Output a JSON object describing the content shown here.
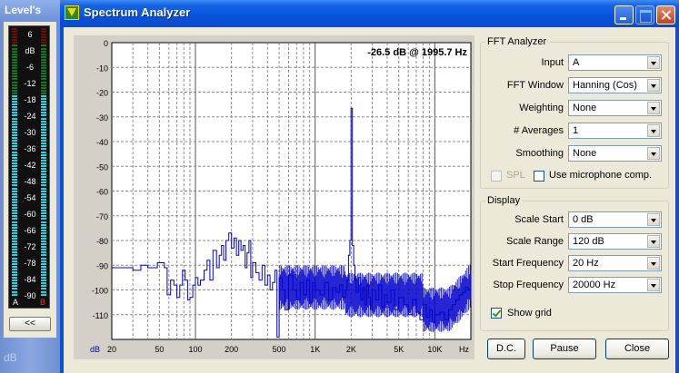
{
  "levels": {
    "title": "Level's",
    "scale": [
      "6",
      "dB",
      "-6",
      "-12",
      "-18",
      "-24",
      "-30",
      "-36",
      "-42",
      "-48",
      "-54",
      "-60",
      "-66",
      "-72",
      "-78",
      "-84",
      "-90"
    ],
    "channel_left": "A",
    "channel_right": "B",
    "collapse_button": "<<",
    "footer_text": "dB",
    "colors": {
      "high": "#ff2020",
      "mid": "#e0e000",
      "active": "#19d8e8",
      "inactive_green": "#0b7a1f",
      "inactive_red": "#6a0c0c"
    }
  },
  "window": {
    "title": "Spectrum Analyzer",
    "icon": "spectrum-app-icon",
    "controls": [
      "minimize-icon",
      "maximize-icon",
      "close-icon"
    ]
  },
  "plot": {
    "readout": "-26.5 dB @ 1995.7 Hz"
  },
  "chart_data": {
    "type": "line",
    "title": "",
    "xlabel": "Hz",
    "ylabel": "dB",
    "x_scale": "log",
    "xlim": [
      20,
      20000
    ],
    "ylim": [
      -120,
      0
    ],
    "x_ticks": [
      "20",
      "50",
      "100",
      "200",
      "500",
      "1K",
      "2K",
      "5K",
      "10K",
      "Hz"
    ],
    "y_ticks": [
      "0",
      "-10",
      "-20",
      "-30",
      "-40",
      "-50",
      "-60",
      "-70",
      "-80",
      "-90",
      "-100",
      "-110",
      "dB"
    ],
    "grid": true,
    "line_color": "#0000cc",
    "series": [
      {
        "x": [
          20,
          30,
          35,
          40,
          48,
          55,
          58,
          62,
          66,
          70,
          74,
          78,
          82,
          86,
          90,
          95,
          100,
          105,
          110,
          118,
          125,
          132,
          140,
          150,
          158,
          165,
          172,
          180,
          190,
          200,
          210,
          220,
          230,
          240,
          250,
          260,
          270,
          280,
          290,
          300,
          320,
          340,
          360,
          380,
          400,
          420,
          440,
          460,
          480,
          500,
          530,
          560,
          600,
          650,
          700,
          750,
          800,
          850,
          900,
          950,
          1000,
          1100,
          1200,
          1300,
          1400,
          1500,
          1600,
          1700,
          1800,
          1850,
          1900,
          1950,
          1995.7,
          2050,
          2100,
          2150,
          2200,
          2300,
          2400,
          2500,
          2600,
          2700,
          2800,
          2900,
          3000,
          3200,
          3400,
          3600,
          3800,
          4000,
          4300,
          4600,
          5000,
          5500,
          6000,
          6500,
          7000,
          7500,
          8000,
          8500,
          9000,
          9500,
          10000,
          11000,
          12000,
          13000,
          14000,
          15000,
          16000,
          17000,
          18000,
          19000,
          20000
        ],
        "y": [
          -91,
          -92,
          -90,
          -91,
          -89,
          -91,
          -102,
          -96,
          -98,
          -103,
          -98,
          -92,
          -96,
          -104,
          -103,
          -98,
          -95,
          -98,
          -96,
          -92,
          -88,
          -96,
          -84,
          -91,
          -86,
          -82,
          -88,
          -80,
          -77,
          -83,
          -79,
          -86,
          -80,
          -84,
          -82,
          -91,
          -85,
          -80,
          -95,
          -89,
          -93,
          -96,
          -90,
          -98,
          -94,
          -100,
          -97,
          -92,
          -119,
          -95,
          -100,
          -108,
          -94,
          -100,
          -104,
          -97,
          -102,
          -96,
          -105,
          -97,
          -100,
          -102,
          -97,
          -104,
          -99,
          -101,
          -98,
          -103,
          -100,
          -96,
          -86,
          -80,
          -26.5,
          -82,
          -90,
          -96,
          -101,
          -95,
          -104,
          -99,
          -106,
          -98,
          -103,
          -108,
          -100,
          -104,
          -98,
          -107,
          -102,
          -105,
          -100,
          -108,
          -103,
          -106,
          -110,
          -104,
          -109,
          -112,
          -106,
          -111,
          -108,
          -113,
          -110,
          -109,
          -112,
          -108,
          -106,
          -104,
          -102,
          -101,
          -99,
          -100,
          -98
        ]
      }
    ]
  },
  "fft_group": {
    "title": "FFT Analyzer",
    "rows": [
      {
        "label": "Input",
        "value": "A"
      },
      {
        "label": "FFT Window",
        "value": "Hanning (Cos)"
      },
      {
        "label": "Weighting",
        "value": "None"
      },
      {
        "label": "# Averages",
        "value": "1"
      },
      {
        "label": "Smoothing",
        "value": "None"
      }
    ],
    "spl_label": "SPL",
    "mic_label": "Use microphone comp."
  },
  "display_group": {
    "title": "Display",
    "rows": [
      {
        "label": "Scale Start",
        "value": "0 dB"
      },
      {
        "label": "Scale Range",
        "value": "120 dB"
      },
      {
        "label": "Start Frequency",
        "value": "20 Hz"
      },
      {
        "label": "Stop Frequency",
        "value": "20000 Hz"
      }
    ],
    "grid_label": "Show grid"
  },
  "buttons": {
    "dc": "D.C.",
    "pause": "Pause",
    "close": "Close"
  }
}
